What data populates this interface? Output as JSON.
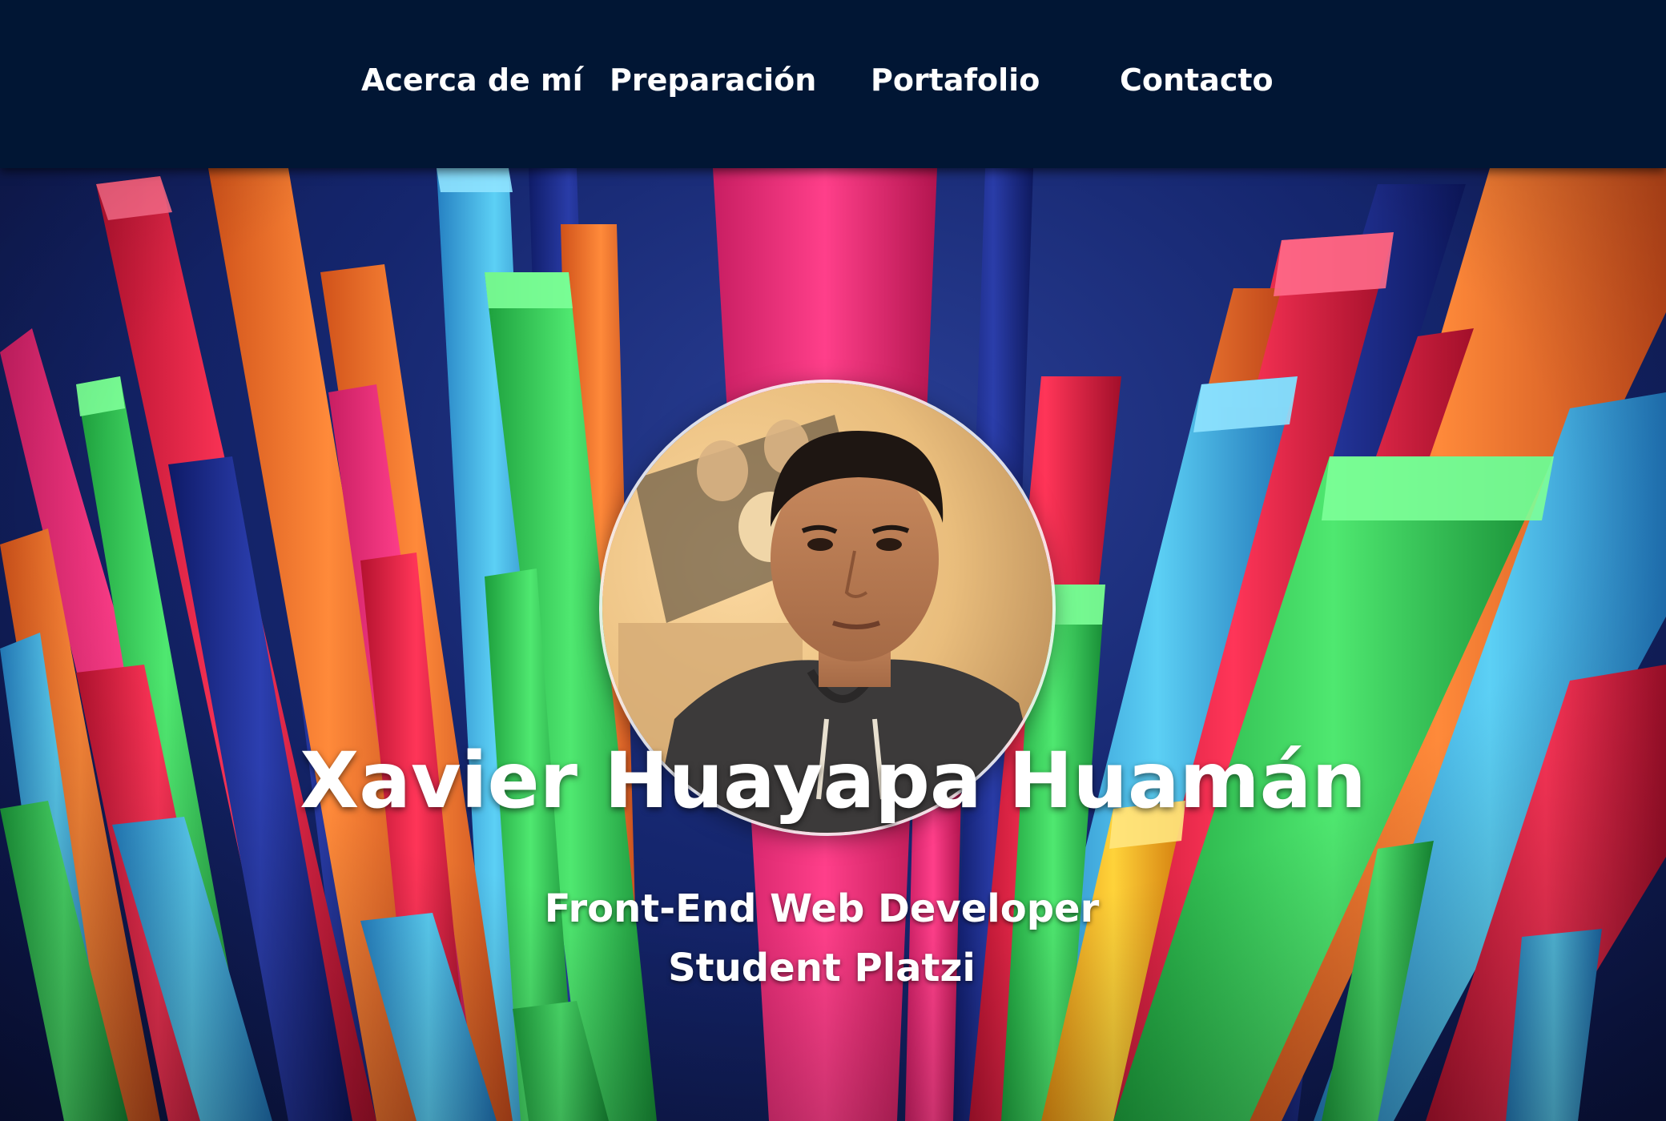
{
  "nav": {
    "items": [
      {
        "label": "Acerca de mí"
      },
      {
        "label": "Preparación"
      },
      {
        "label": "Portafolio"
      },
      {
        "label": "Contacto"
      }
    ]
  },
  "hero": {
    "name": "Xavier Huayapa Huamán",
    "subtitle_line1": "Front-End Web Developer",
    "subtitle_line2": "Student Platzi"
  },
  "colors": {
    "nav_background": "#011634",
    "text": "#ffffff",
    "bar_pink": "#f0327a",
    "bar_orange": "#f2752a",
    "bar_green": "#34d45a",
    "bar_blue": "#3fb6e6",
    "bar_red": "#e8244e",
    "bar_navy": "#1b2a8a"
  }
}
